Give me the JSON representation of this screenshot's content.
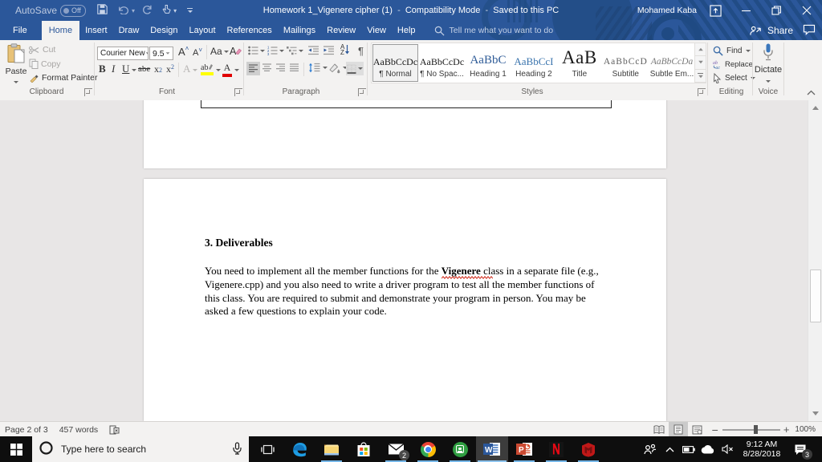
{
  "window": {
    "autosave_label": "AutoSave",
    "autosave_state": "Off",
    "doc_title": "Homework 1_Vigenere cipher (1)",
    "mode": "Compatibility Mode",
    "save_status": "Saved to this PC",
    "user_name": "Mohamed Kaba"
  },
  "tabs": {
    "file": "File",
    "home": "Home",
    "insert": "Insert",
    "draw": "Draw",
    "design": "Design",
    "layout": "Layout",
    "references": "References",
    "mailings": "Mailings",
    "review": "Review",
    "view": "View",
    "help": "Help",
    "tell_me": "Tell me what you want to do",
    "share": "Share"
  },
  "ribbon": {
    "clipboard": {
      "label": "Clipboard",
      "paste": "Paste",
      "cut": "Cut",
      "copy": "Copy",
      "format_painter": "Format Painter"
    },
    "font": {
      "label": "Font",
      "family": "Courier New",
      "size": "9.5",
      "bold": "B",
      "italic": "I",
      "underline": "U",
      "strike": "abe",
      "subscript": "x",
      "sub2": "2",
      "superscript": "x",
      "sup2": "2",
      "effects": "A",
      "highlight": "ab",
      "fontcolor": "A",
      "grow": "A",
      "shrink": "A",
      "changecase": "Aa",
      "clear": "A"
    },
    "paragraph": {
      "label": "Paragraph",
      "sort": "A",
      "sortz": "Z",
      "pilcrow": "¶"
    },
    "styles": {
      "label": "Styles",
      "items": [
        {
          "sample": "AaBbCcDc",
          "name": "¶ Normal"
        },
        {
          "sample": "AaBbCcDc",
          "name": "¶ No Spac..."
        },
        {
          "sample": "AaBbC",
          "name": "Heading 1"
        },
        {
          "sample": "AaBbCcI",
          "name": "Heading 2"
        },
        {
          "sample": "AaB",
          "name": "Title"
        },
        {
          "sample": "AaBbCcD",
          "name": "Subtitle"
        },
        {
          "sample": "AaBbCcDa",
          "name": "Subtle Em..."
        }
      ]
    },
    "editing": {
      "label": "Editing",
      "find": "Find",
      "replace": "Replace",
      "select": "Select"
    },
    "voice": {
      "label": "Voice",
      "dictate": "Dictate"
    }
  },
  "document": {
    "heading": "3. Deliverables",
    "body_before": "You need to implement all the member functions for the ",
    "body_bold": "Vigenere",
    "body_after": " class in a separate file (e.g., Vigenere.cpp) and you also need to write a driver program to test all the member functions of this class. You are required to submit and demonstrate your program in person. You may be asked a few questions to explain your code."
  },
  "statusbar": {
    "page": "Page 2 of 3",
    "words": "457 words",
    "zoom": "100%"
  },
  "taskbar": {
    "search_placeholder": "Type here to search",
    "time": "9:12 AM",
    "date": "8/28/2018",
    "mail_badge": "2",
    "notifications_badge": "3"
  },
  "colors": {
    "titlebar_blue": "#2b579a",
    "ribbon_bg": "#f3f2f1",
    "doc_bg": "#e8e6e6",
    "taskbar_black": "#0e0e0e",
    "open_app_underline": "#75b6e8",
    "heading1_blue": "#2e5b97",
    "word_icon_blue": "#2b579a"
  }
}
